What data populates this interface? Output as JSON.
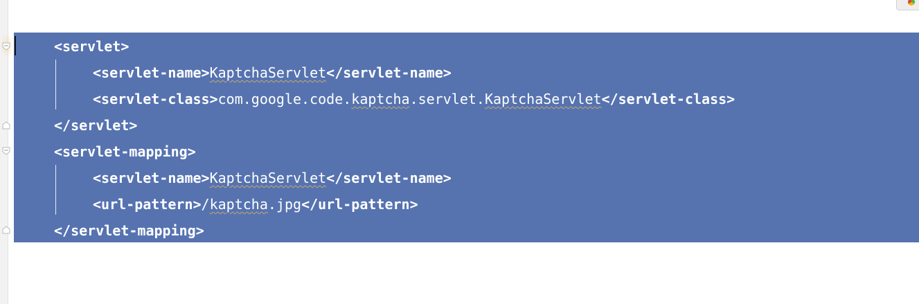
{
  "editor": {
    "selection_color": "#5673b0",
    "lines": [
      {
        "open": "<servlet>"
      },
      {
        "open_tag": "<servlet-name>",
        "value": "KaptchaServlet",
        "close_tag": "</servlet-name>"
      },
      {
        "open_tag": "<servlet-class>",
        "value_prefix": "com.google.code.",
        "value_word1": "kaptcha",
        "value_mid": ".servlet.",
        "value_word2": "KaptchaServlet",
        "close_tag": "</servlet-class>"
      },
      {
        "close": "</servlet>"
      },
      {
        "open": "<servlet-mapping>"
      },
      {
        "open_tag": "<servlet-name>",
        "value": "KaptchaServlet",
        "close_tag": "</servlet-name>"
      },
      {
        "open_tag": "<url-pattern>",
        "value_prefix": "/",
        "value_word": "kaptcha",
        "value_suffix": ".jpg",
        "close_tag": "</url-pattern>"
      },
      {
        "close": "</servlet-mapping>"
      }
    ]
  }
}
